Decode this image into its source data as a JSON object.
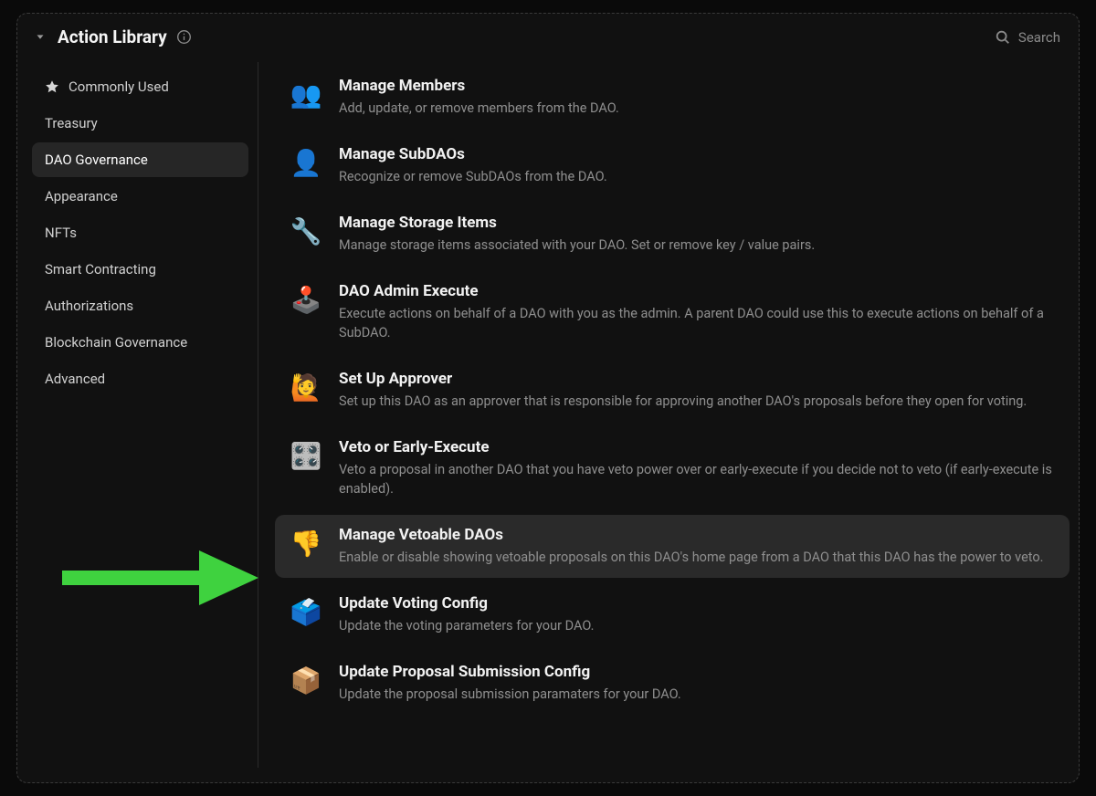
{
  "header": {
    "title": "Action Library",
    "search_placeholder": "Search"
  },
  "sidebar": {
    "items": [
      {
        "label": "Commonly Used",
        "star": true,
        "active": false
      },
      {
        "label": "Treasury",
        "star": false,
        "active": false
      },
      {
        "label": "DAO Governance",
        "star": false,
        "active": true
      },
      {
        "label": "Appearance",
        "star": false,
        "active": false
      },
      {
        "label": "NFTs",
        "star": false,
        "active": false
      },
      {
        "label": "Smart Contracting",
        "star": false,
        "active": false
      },
      {
        "label": "Authorizations",
        "star": false,
        "active": false
      },
      {
        "label": "Blockchain Governance",
        "star": false,
        "active": false
      },
      {
        "label": "Advanced",
        "star": false,
        "active": false
      }
    ]
  },
  "actions": [
    {
      "icon": "👥",
      "title": "Manage Members",
      "desc": "Add, update, or remove members from the DAO.",
      "highlight": false
    },
    {
      "icon": "👤",
      "title": "Manage SubDAOs",
      "desc": "Recognize or remove SubDAOs from the DAO.",
      "highlight": false
    },
    {
      "icon": "🔧",
      "title": "Manage Storage Items",
      "desc": "Manage storage items associated with your DAO. Set or remove key / value pairs.",
      "highlight": false
    },
    {
      "icon": "🕹️",
      "title": "DAO Admin Execute",
      "desc": "Execute actions on behalf of a DAO with you as the admin. A parent DAO could use this to execute actions on behalf of a SubDAO.",
      "highlight": false
    },
    {
      "icon": "🙋",
      "title": "Set Up Approver",
      "desc": "Set up this DAO as an approver that is responsible for approving another DAO's proposals before they open for voting.",
      "highlight": false
    },
    {
      "icon": "🎛️",
      "title": "Veto or Early-Execute",
      "desc": "Veto a proposal in another DAO that you have veto power over or early-execute if you decide not to veto (if early-execute is enabled).",
      "highlight": false
    },
    {
      "icon": "👎",
      "title": "Manage Vetoable DAOs",
      "desc": "Enable or disable showing vetoable proposals on this DAO's home page from a DAO that this DAO has the power to veto.",
      "highlight": true
    },
    {
      "icon": "🗳️",
      "title": "Update Voting Config",
      "desc": "Update the voting parameters for your DAO.",
      "highlight": false
    },
    {
      "icon": "📦",
      "title": "Update Proposal Submission Config",
      "desc": "Update the proposal submission paramaters for your DAO.",
      "highlight": false
    }
  ],
  "annotation": {
    "arrow_color": "#3fd23f"
  }
}
